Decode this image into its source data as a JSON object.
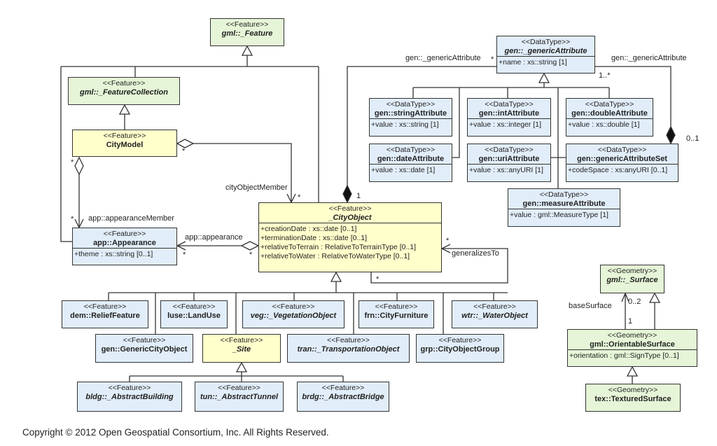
{
  "colors": {
    "feature_core": "#ffffcc",
    "gml": "#e6f5d7",
    "module": "#e1edf9",
    "border": "#333333"
  },
  "classes": [
    {
      "id": "gml_feature",
      "stereotype": "<<Feature>>",
      "name": "gml::_Feature",
      "abstract": true,
      "color": "gml",
      "attributes": []
    },
    {
      "id": "feature_collection",
      "stereotype": "<<Feature>>",
      "name": "gml::_FeatureCollection",
      "abstract": true,
      "color": "gml",
      "attributes": []
    },
    {
      "id": "city_model",
      "stereotype": "<<Feature>>",
      "name": "CityModel",
      "abstract": false,
      "color": "feature_core",
      "attributes": []
    },
    {
      "id": "appearance",
      "stereotype": "<<Feature>>",
      "name": "app::Appearance",
      "abstract": false,
      "color": "module",
      "attributes": [
        "+theme : xs::string [0..1]"
      ]
    },
    {
      "id": "city_object",
      "stereotype": "<<Feature>>",
      "name": "_CityObject",
      "abstract": true,
      "color": "feature_core",
      "attributes": [
        "+creationDate : xs::date [0..1]",
        "+terminationDate : xs::date [0..1]",
        "+relativeToTerrain : RelativeToTerrainType [0..1]",
        "+relativeToWater : RelativeToWaterType [0..1]"
      ]
    },
    {
      "id": "generic_attribute",
      "stereotype": "<<DataType>>",
      "name": "gen::_genericAttribute",
      "abstract": true,
      "color": "module",
      "attributes": [
        "+name : xs::string [1]"
      ]
    },
    {
      "id": "string_attribute",
      "stereotype": "<<DataType>>",
      "name": "gen::stringAttribute",
      "abstract": false,
      "color": "module",
      "attributes": [
        "+value : xs::string [1]"
      ]
    },
    {
      "id": "int_attribute",
      "stereotype": "<<DataType>>",
      "name": "gen::intAttribute",
      "abstract": false,
      "color": "module",
      "attributes": [
        "+value : xs::integer [1]"
      ]
    },
    {
      "id": "double_attribute",
      "stereotype": "<<DataType>>",
      "name": "gen::doubleAttribute",
      "abstract": false,
      "color": "module",
      "attributes": [
        "+value : xs::double [1]"
      ]
    },
    {
      "id": "date_attribute",
      "stereotype": "<<DataType>>",
      "name": "gen::dateAttribute",
      "abstract": false,
      "color": "module",
      "attributes": [
        "+value : xs::date [1]"
      ]
    },
    {
      "id": "uri_attribute",
      "stereotype": "<<DataType>>",
      "name": "gen::uriAttribute",
      "abstract": false,
      "color": "module",
      "attributes": [
        "+value : xs::anyURI [1]"
      ]
    },
    {
      "id": "generic_attribute_set",
      "stereotype": "<<DataType>>",
      "name": "gen::genericAttributeSet",
      "abstract": false,
      "color": "module",
      "attributes": [
        "+codeSpace : xs:anyURI [0..1]"
      ]
    },
    {
      "id": "measure_attribute",
      "stereotype": "<<DataType>>",
      "name": "gen::measureAttribute",
      "abstract": false,
      "color": "module",
      "attributes": [
        "+value : gml::MeasureType [1]"
      ]
    },
    {
      "id": "relief_feature",
      "stereotype": "<<Feature>>",
      "name": "dem::ReliefFeature",
      "abstract": false,
      "color": "module",
      "attributes": []
    },
    {
      "id": "land_use",
      "stereotype": "<<Feature>>",
      "name": "luse::LandUse",
      "abstract": false,
      "color": "module",
      "attributes": []
    },
    {
      "id": "vegetation_object",
      "stereotype": "<<Feature>>",
      "name": "veg::_VegetationObject",
      "abstract": true,
      "color": "module",
      "attributes": []
    },
    {
      "id": "city_furniture",
      "stereotype": "<<Feature>>",
      "name": "frn::CityFurniture",
      "abstract": false,
      "color": "module",
      "attributes": []
    },
    {
      "id": "water_object",
      "stereotype": "<<Feature>>",
      "name": "wtr::_WaterObject",
      "abstract": true,
      "color": "module",
      "attributes": []
    },
    {
      "id": "generic_city_object",
      "stereotype": "<<Feature>>",
      "name": "gen::GenericCityObject",
      "abstract": false,
      "color": "module",
      "attributes": []
    },
    {
      "id": "site",
      "stereotype": "<<Feature>>",
      "name": "_Site",
      "abstract": true,
      "color": "feature_core",
      "attributes": []
    },
    {
      "id": "transportation_object",
      "stereotype": "<<Feature>>",
      "name": "tran::_TransportationObject",
      "abstract": true,
      "color": "module",
      "attributes": []
    },
    {
      "id": "city_object_group",
      "stereotype": "<<Feature>>",
      "name": "grp::CityObjectGroup",
      "abstract": false,
      "color": "module",
      "attributes": []
    },
    {
      "id": "abstract_building",
      "stereotype": "<<Feature>>",
      "name": "bldg::_AbstractBuilding",
      "abstract": true,
      "color": "module",
      "attributes": []
    },
    {
      "id": "abstract_tunnel",
      "stereotype": "<<Feature>>",
      "name": "tun::_AbstractTunnel",
      "abstract": true,
      "color": "module",
      "attributes": []
    },
    {
      "id": "abstract_bridge",
      "stereotype": "<<Feature>>",
      "name": "brdg::_AbstractBridge",
      "abstract": true,
      "color": "module",
      "attributes": []
    },
    {
      "id": "surface",
      "stereotype": "<<Geometry>>",
      "name": "gml::_Surface",
      "abstract": true,
      "color": "gml",
      "attributes": []
    },
    {
      "id": "orientable_surface",
      "stereotype": "<<Geometry>>",
      "name": "gml::OrientableSurface",
      "abstract": false,
      "color": "gml",
      "attributes": [
        "+orientation : gml::SignType [0..1]"
      ]
    },
    {
      "id": "textured_surface",
      "stereotype": "<<Geometry>>",
      "name": "tex::TexturedSurface",
      "abstract": false,
      "color": "gml",
      "attributes": []
    }
  ],
  "labels": {
    "city_object_member": "cityObjectMember",
    "city_object_member_mult": "*",
    "city_model_agg_mult": "*",
    "appearance_member": "app::appearanceMember",
    "appearance_member_mult_top": "*",
    "appearance_member_mult_bottom": "*",
    "app_appearance": "app::appearance",
    "app_appearance_mult_left": "*",
    "app_appearance_mult_right": "*",
    "generic_attr_left": "gen::_genericAttribute",
    "generic_attr_left_mult": "*",
    "generic_attr_left_one": "1",
    "generic_attr_right": "gen::_genericAttribute",
    "generic_attr_right_mult": "1..*",
    "generic_attr_set_mult": "0..1",
    "generalizes_to": "generalizesTo",
    "generalizes_to_mult_top": "*",
    "generalizes_to_mult_bottom": "*",
    "base_surface": "baseSurface",
    "base_surface_mult": "0..2",
    "base_surface_one": "1"
  },
  "footer": "Copyright © 2012 Open Geospatial Consortium, Inc. All Rights Reserved."
}
